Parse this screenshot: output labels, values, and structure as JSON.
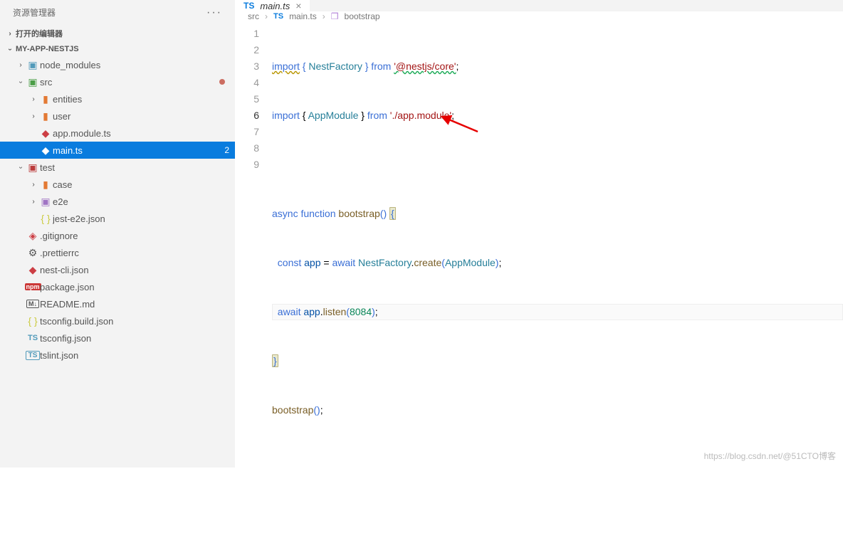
{
  "sidebar": {
    "title": "资源管理器",
    "open_editors_label": "打开的编辑器",
    "project_name": "MY-APP-NESTJS",
    "items": [
      {
        "label": "node_modules"
      },
      {
        "label": "src"
      },
      {
        "label": "entities"
      },
      {
        "label": "user"
      },
      {
        "label": "app.module.ts"
      },
      {
        "label": "main.ts",
        "badge": "2"
      },
      {
        "label": "test"
      },
      {
        "label": "case"
      },
      {
        "label": "e2e"
      },
      {
        "label": "jest-e2e.json"
      },
      {
        "label": ".gitignore"
      },
      {
        "label": ".prettierrc"
      },
      {
        "label": "nest-cli.json"
      },
      {
        "label": "package.json"
      },
      {
        "label": "README.md"
      },
      {
        "label": "tsconfig.build.json"
      },
      {
        "label": "tsconfig.json"
      },
      {
        "label": "tslint.json"
      }
    ]
  },
  "tab": {
    "icon": "TS",
    "label": "main.ts"
  },
  "breadcrumb": {
    "p0": "src",
    "p1": "main.ts",
    "p2": "bootstrap",
    "icon": "TS"
  },
  "code": {
    "l1": {
      "a": "import",
      "b": "{",
      "c": " NestFactory ",
      "d": "}",
      "e": " from ",
      "f": "'@nestjs/core'",
      "g": ";"
    },
    "l2": {
      "a": "import",
      "b": " { ",
      "c": "AppModule",
      "d": " } ",
      "e": "from ",
      "f": "'./app.module'",
      "g": ";"
    },
    "l4": {
      "a": "async",
      "b": " function ",
      "c": "bootstrap",
      "d": "(",
      "e": ")",
      "f": " ",
      "g": "{"
    },
    "l5": {
      "a": "  const",
      "b": " app ",
      "c": "= ",
      "d": "await",
      "e": " NestFactory",
      "f": ".",
      "g": "create",
      "h": "(",
      "i": "AppModule",
      "j": ")",
      "k": ";"
    },
    "l6": {
      "a": "  await",
      "b": " app",
      "c": ".",
      "d": "listen",
      "e": "(",
      "f": "8084",
      "g": ")",
      "h": ";"
    },
    "l7": {
      "a": "}"
    },
    "l8": {
      "a": "bootstrap",
      "b": "(",
      "c": ")",
      "d": ";"
    }
  },
  "line_numbers": [
    "1",
    "2",
    "3",
    "4",
    "5",
    "6",
    "7",
    "8",
    "9"
  ],
  "watermark": "https://blog.csdn.net/@51CTO博客"
}
